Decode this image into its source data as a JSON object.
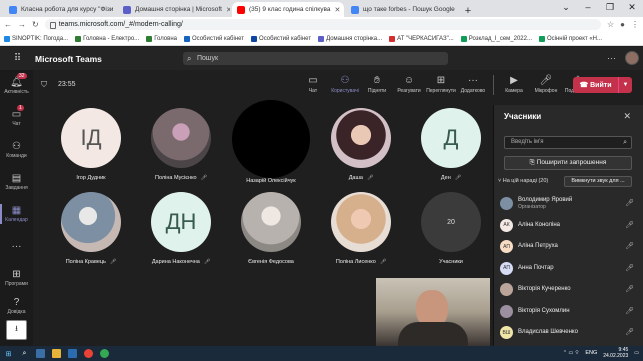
{
  "browser": {
    "tabs": [
      {
        "title": "Класна робота для курсу \"Фізи",
        "color": "#4285f4"
      },
      {
        "title": "Домашня сторінка | Microsoft ",
        "color": "#5b5fc7"
      },
      {
        "title": "(35) 9 клас година спілкува",
        "color": "#ff0000",
        "active": true
      },
      {
        "title": "що таке forbes - Пошук Google",
        "color": "#4285f4"
      }
    ],
    "url": "teams.microsoft.com/_#/modern-calling/",
    "bookmarks": [
      {
        "label": "SINOPTIK: Погода...",
        "color": "#1e88e5"
      },
      {
        "label": "Головна - Електро...",
        "color": "#2e7d32"
      },
      {
        "label": "Головна",
        "color": "#2e7d32"
      },
      {
        "label": "Особистий кабінет",
        "color": "#1565c0"
      },
      {
        "label": "Особистий кабінет",
        "color": "#0d47a1"
      },
      {
        "label": "Домашня сторінка...",
        "color": "#5b5fc7"
      },
      {
        "label": "АТ \"ЧЕРКАСИГАЗ\"...",
        "color": "#d32f2f"
      },
      {
        "label": "Розклад_І_сем_2022...",
        "color": "#0f9d58"
      },
      {
        "label": "Осінній проект «Н...",
        "color": "#0f9d58"
      }
    ]
  },
  "teams": {
    "app_name": "Microsoft Teams",
    "search_placeholder": "Пошук",
    "timer": "23:55",
    "rail": [
      {
        "label": "Активність",
        "icon": "bell-icon",
        "badge": "32"
      },
      {
        "label": "Чат",
        "icon": "chat-icon",
        "badge": "1"
      },
      {
        "label": "Команди",
        "icon": "teams-icon"
      },
      {
        "label": "Завдання",
        "icon": "assignments-icon"
      },
      {
        "label": "Календар",
        "icon": "calendar-icon",
        "active": true
      },
      {
        "label": "...",
        "icon": "more-icon"
      },
      {
        "label": "Програми",
        "icon": "apps-icon"
      },
      {
        "label": "Довідка",
        "icon": "help-icon"
      }
    ],
    "controls": [
      {
        "label": "Чат",
        "icon": "chat-icon"
      },
      {
        "label": "Користувачі",
        "icon": "people-icon",
        "active": true
      },
      {
        "label": "Підняти",
        "icon": "raise-hand-icon"
      },
      {
        "label": "Реагувати",
        "icon": "react-icon"
      },
      {
        "label": "Переглянути",
        "icon": "view-icon"
      },
      {
        "label": "Додатково",
        "icon": "more-icon"
      },
      {
        "label": "Камера",
        "icon": "camera-icon"
      },
      {
        "label": "Мікрофон",
        "icon": "mic-icon"
      },
      {
        "label": "Поділитися",
        "icon": "share-icon"
      }
    ],
    "leave_label": "Вийти",
    "tiles": [
      {
        "name": "Ігор Дудник",
        "initials": "ІД",
        "kind": "initials"
      },
      {
        "name": "Поліна Мусієнко",
        "kind": "photo1"
      },
      {
        "name": "Назарій Олексійчук",
        "kind": "photo2"
      },
      {
        "name": "Даша",
        "kind": "photo3"
      },
      {
        "name": "Ден",
        "initials": "Д",
        "kind": "teal"
      },
      {
        "name": "Поліна Кравець",
        "kind": "photo4"
      },
      {
        "name": "Дарина Наконечна",
        "initials": "ДН",
        "kind": "teal"
      },
      {
        "name": "Євгенія Федосова",
        "kind": "photo5"
      },
      {
        "name": "Поліна Лисенко",
        "kind": "photo6"
      },
      {
        "name": "Учасники",
        "initials": "20",
        "kind": "grey"
      }
    ],
    "panel": {
      "title": "Учасники",
      "search_placeholder": "Введіть ім'я",
      "share_label": "Поширити запрошення",
      "section_label": "На цій нараді (20)",
      "mute_all_label": "Вимкнути звук для ...",
      "participants": [
        {
          "name": "Володимир Яровий",
          "role": "Організатор",
          "initials": "",
          "color": "#7d8fa3"
        },
        {
          "name": "Аліна Коноліна",
          "initials": "АК",
          "color": "#f3e8e4"
        },
        {
          "name": "Аліна Петруха",
          "initials": "АП",
          "color": "#f8dcc4"
        },
        {
          "name": "Анна Почтар",
          "initials": "АП",
          "color": "#d7dcf5"
        },
        {
          "name": "Вікторія Кучеренко",
          "initials": "",
          "color": "#bba59b"
        },
        {
          "name": "Вікторія Сухомлин",
          "initials": "",
          "color": "#9c8fa0"
        },
        {
          "name": "Владислав Шевченко",
          "initials": "ВШ",
          "color": "#f0e6a8"
        }
      ]
    }
  },
  "taskbar": {
    "time": "9:45",
    "date": "24.02.2023",
    "lang": "ENG"
  }
}
